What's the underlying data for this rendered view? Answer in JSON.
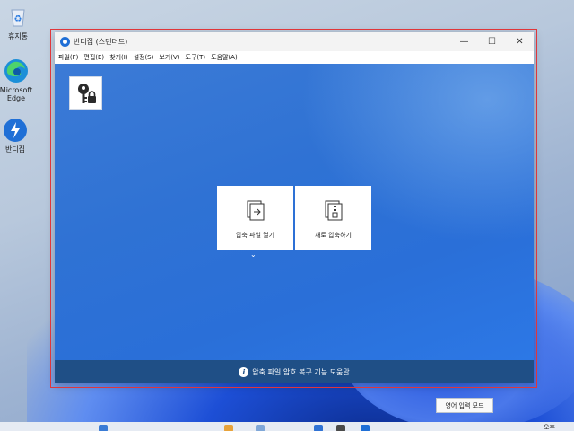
{
  "desktop": {
    "icons": [
      {
        "label": "휴지통",
        "icon": "recycle-bin-icon"
      },
      {
        "label": "Microsoft Edge",
        "icon": "edge-icon"
      },
      {
        "label": "반디집",
        "icon": "bandizip-icon"
      }
    ]
  },
  "window": {
    "title": "반디집 (스탠더드)",
    "controls": {
      "minimize": "—",
      "maximize": "☐",
      "close": "✕"
    },
    "menu": [
      "파일(F)",
      "편집(E)",
      "찾기(I)",
      "설정(S)",
      "보기(V)",
      "도구(T)",
      "도움말(A)"
    ],
    "cards": [
      {
        "label": "압축 파일 열기",
        "icon": "open-archive-icon"
      },
      {
        "label": "새로 압축하기",
        "icon": "new-archive-icon"
      }
    ],
    "toolbar_icon": "password-key-icon",
    "bottom_help": "압축 파일 암호 복구 기능 도움말"
  },
  "ime_tooltip": "영어 입력 모드",
  "clock": "오후 ",
  "colors": {
    "accent": "#2f72d4",
    "bottombar": "#1f4f86",
    "selection": "#e0363a"
  }
}
